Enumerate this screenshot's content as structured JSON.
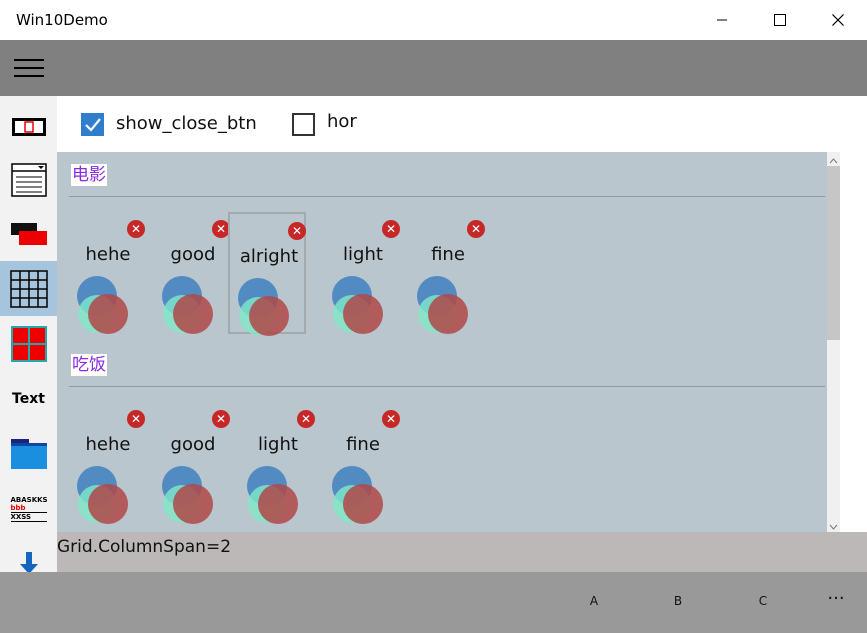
{
  "window": {
    "title": "Win10Demo",
    "minimize_glyph": "—",
    "maximize_glyph": "☐",
    "close_glyph": "✕"
  },
  "nav": {
    "text_item_label": "Text",
    "selected_index": 3,
    "icons": [
      "button-icon",
      "list-window-icon",
      "overlap-rects-icon",
      "grid-icon",
      "tiles-icon",
      "text-icon",
      "folder-icon",
      "text-styles-icon",
      "download-icon"
    ],
    "text_styles_glyph_lines": [
      "ABASKKS",
      "bbb",
      "XXSS"
    ]
  },
  "options": {
    "show_close_btn": {
      "label": "show_close_btn",
      "checked": true
    },
    "hor": {
      "label": "hor",
      "checked": false
    }
  },
  "groups": [
    {
      "header": "电影",
      "items": [
        "hehe",
        "good",
        "alright",
        "light",
        "fine"
      ],
      "selected_index": 2
    },
    {
      "header": "吃饭",
      "items": [
        "hehe",
        "good",
        "light",
        "fine"
      ],
      "selected_index": -1
    }
  ],
  "status": {
    "text": "Grid.ColumnSpan=2"
  },
  "commands": {
    "a": "A",
    "b": "B",
    "c": "C",
    "more": "···"
  },
  "colors": {
    "accent": "#2f7dcc",
    "content_bg": "#b9c6cd",
    "group_header": "#8a2be2",
    "close_badge": "#c62828",
    "venn_blue": "#3f7fbf",
    "venn_teal": "#7fe8c8",
    "venn_red": "#b04848"
  }
}
